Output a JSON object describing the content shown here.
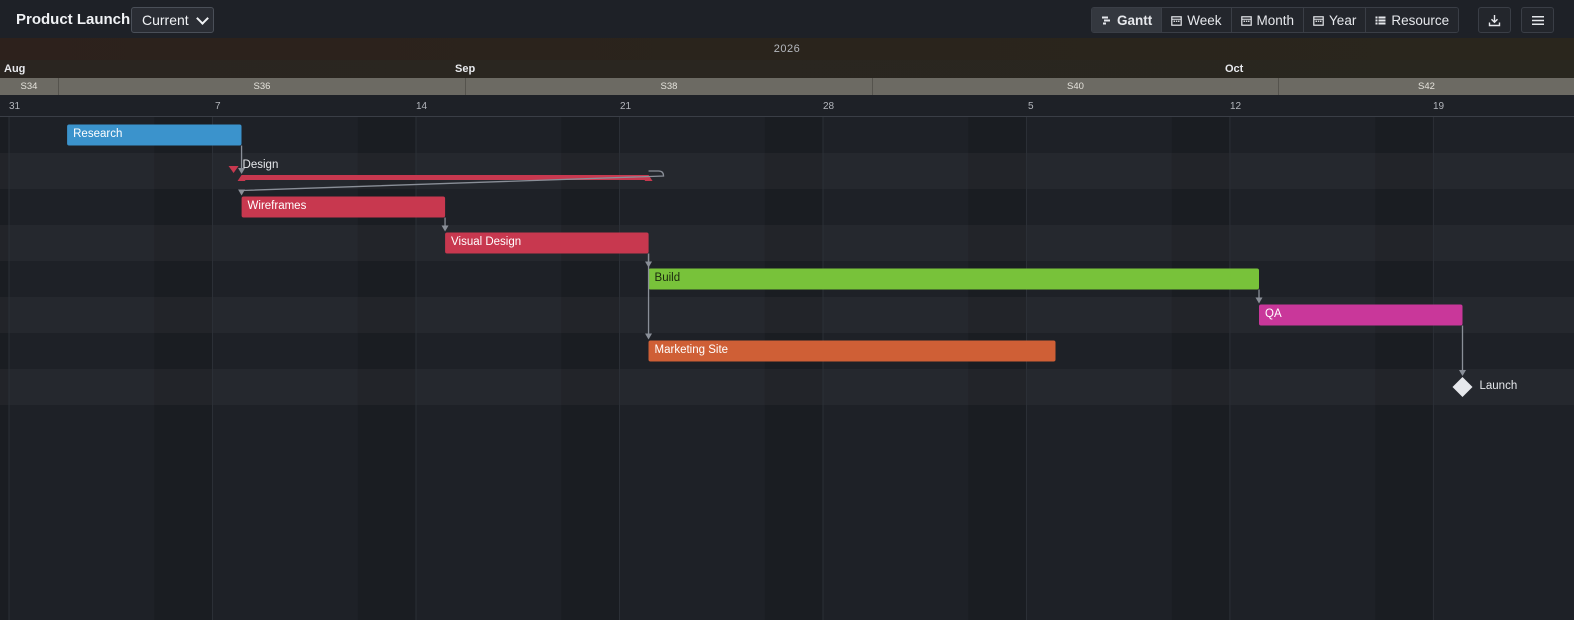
{
  "toolbar": {
    "title": "Product Launch",
    "version_selected": "Current",
    "views": [
      {
        "label": "Gantt",
        "icon": "gantt-icon",
        "active": true
      },
      {
        "label": "Week",
        "icon": "calendar-icon",
        "active": false
      },
      {
        "label": "Month",
        "icon": "calendar-icon",
        "active": false
      },
      {
        "label": "Year",
        "icon": "calendar-icon",
        "active": false
      },
      {
        "label": "Resource",
        "icon": "list-icon",
        "active": false
      }
    ],
    "export_icon": "download-icon",
    "menu_icon": "hamburger-menu-icon"
  },
  "timeline": {
    "year": "2026",
    "months": [
      "Aug",
      "Sep",
      "Oct"
    ],
    "weeks": [
      "S34",
      "S36",
      "S38",
      "S40",
      "S42"
    ],
    "days": [
      "31",
      "7",
      "14",
      "21",
      "28",
      "5",
      "12",
      "19"
    ]
  },
  "tasks": [
    {
      "name": "Research",
      "type": "task",
      "start": "2026-09-02",
      "end": "2026-09-08",
      "color": "#3b93cc"
    },
    {
      "name": "Design",
      "type": "summary",
      "start": "2026-09-08",
      "end": "2026-09-22",
      "color": "#c8384f"
    },
    {
      "name": "Wireframes",
      "type": "task",
      "start": "2026-09-08",
      "end": "2026-09-15",
      "color": "#c8384f"
    },
    {
      "name": "Visual Design",
      "type": "task",
      "start": "2026-09-15",
      "end": "2026-09-22",
      "color": "#c8384f"
    },
    {
      "name": "Build",
      "type": "task",
      "start": "2026-09-22",
      "end": "2026-10-13",
      "color": "#78c23a"
    },
    {
      "name": "QA",
      "type": "task",
      "start": "2026-10-13",
      "end": "2026-10-20",
      "color": "#c9379a"
    },
    {
      "name": "Marketing Site",
      "type": "task",
      "start": "2026-09-22",
      "end": "2026-10-06",
      "color": "#cf5f36"
    },
    {
      "name": "Launch",
      "type": "milestone",
      "start": "2026-10-20",
      "color": "#e6e8ec"
    }
  ],
  "dependencies": [
    [
      "Research",
      "Design"
    ],
    [
      "Design",
      "Wireframes"
    ],
    [
      "Wireframes",
      "Visual Design"
    ],
    [
      "Visual Design",
      "Build"
    ],
    [
      "Visual Design",
      "Marketing Site"
    ],
    [
      "Build",
      "QA"
    ],
    [
      "QA",
      "Launch"
    ]
  ]
}
